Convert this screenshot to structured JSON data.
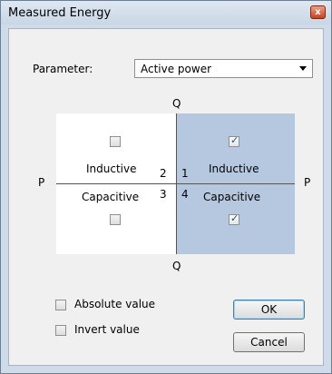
{
  "window": {
    "title": "Measured Energy",
    "close_glyph": "x"
  },
  "parameter": {
    "label": "Parameter:",
    "selected": "Active power"
  },
  "axes": {
    "q_top": "Q",
    "q_bottom": "Q",
    "p_left": "P",
    "p_right": "P"
  },
  "quadrants": {
    "q1": {
      "number": "1",
      "label": "Inductive",
      "checked": true
    },
    "q2": {
      "number": "2",
      "label": "Inductive",
      "checked": false
    },
    "q3": {
      "number": "3",
      "label": "Capacitive",
      "checked": false
    },
    "q4": {
      "number": "4",
      "label": "Capacitive",
      "checked": true
    }
  },
  "options": {
    "absolute_value": {
      "label": "Absolute value",
      "checked": false
    },
    "invert_value": {
      "label": "Invert value",
      "checked": false
    }
  },
  "buttons": {
    "ok": "OK",
    "cancel": "Cancel"
  },
  "colors": {
    "highlight_quadrant": "#b5c8df",
    "frame": "#cfdbe8"
  }
}
